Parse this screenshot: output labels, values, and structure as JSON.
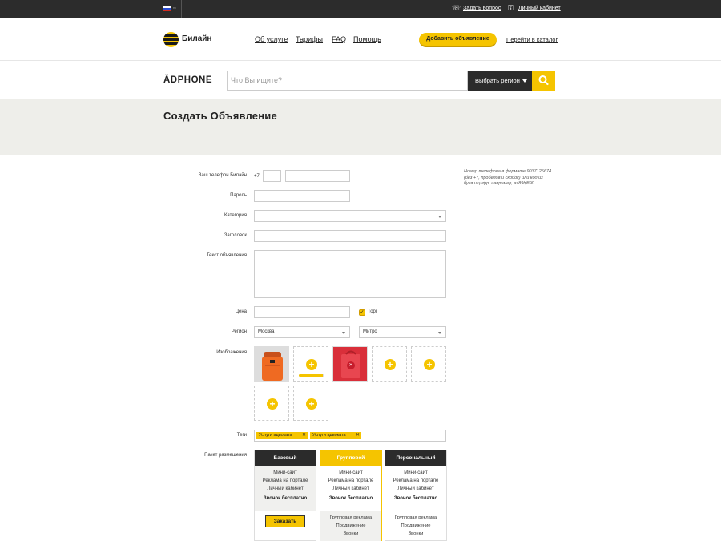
{
  "topbar": {
    "lang": "ru",
    "ask_question": "Задать вопрос",
    "cabinet": "Личный кабинет"
  },
  "header": {
    "logo_text": "Билайн",
    "nav": [
      "Об услуге",
      "Тарифы",
      "FAQ",
      "Помощь"
    ],
    "add_listing": "Добавить объявление",
    "catalog_link": "Перейти в каталог"
  },
  "search": {
    "brand": "ÄDPHONE",
    "placeholder": "Что Вы ищите?",
    "region_button": "Выбрать регион"
  },
  "page_title": "Создать Объявление",
  "form": {
    "phone_label": "Ваш телефон Билайн",
    "phone_prefix": "+7",
    "phone_hint": "Номер телефона в формате 9037125674 (без +7, пробелов и скобок) или код из букв и цифр, например, as89hj890.",
    "password_label": "Пароль",
    "category_label": "Категория",
    "heading_label": "Заголовок",
    "text_label": "Текст объявления",
    "price_label": "Цена",
    "bargain_label": "Торг",
    "bargain_checked": true,
    "region_label": "Регион",
    "region_value": "Москва",
    "metro_value": "Митро",
    "images_label": "Изображения",
    "upload_progress": 0.95,
    "tags_label": "Теги",
    "tags": [
      "Услуги адвоката",
      "Услуги адвоката"
    ],
    "package_label": "Пакет размещения"
  },
  "packages": [
    {
      "name": "Базовый",
      "features": [
        "Мини-сайт",
        "Реклама на портале",
        "Личный кабинет"
      ],
      "call": "Звонок бесплатно",
      "extras": [],
      "order_label": "Заказать"
    },
    {
      "name": "Групповой",
      "features": [
        "Мини-сайт",
        "Реклама на портале",
        "Личный кабинет"
      ],
      "call": "Звонок бесплатно",
      "extras": [
        "Групповая реклама",
        "Продвижение",
        "Звонки"
      ]
    },
    {
      "name": "Персональный",
      "features": [
        "Мини-сайт",
        "Реклама на портале",
        "Личный кабинет"
      ],
      "call": "Звонок бесплатно",
      "extras": [
        "Групповая реклама",
        "Продвижение",
        "Звонки"
      ]
    }
  ],
  "colors": {
    "accent": "#f5c400",
    "dark": "#2b2b2b",
    "band": "#eeeeea"
  }
}
